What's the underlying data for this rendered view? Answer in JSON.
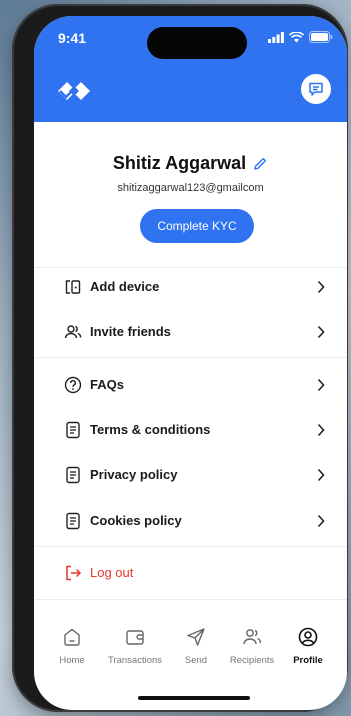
{
  "status": {
    "time": "9:41"
  },
  "header": {
    "brand_color": "#2f73f1"
  },
  "profile": {
    "name": "Shitiz Aggarwal",
    "email": "shitizaggarwal123@gmailcom",
    "kyc_label": "Complete KYC"
  },
  "menu": {
    "add_device": "Add device",
    "invite_friends": "Invite friends",
    "faqs": "FAQs",
    "terms": "Terms & conditions",
    "privacy": "Privacy policy",
    "cookies": "Cookies policy",
    "logout": "Log out"
  },
  "tabs": [
    {
      "label": "Home",
      "icon": "home-icon"
    },
    {
      "label": "Transactions",
      "icon": "wallet-icon"
    },
    {
      "label": "Send",
      "icon": "send-icon"
    },
    {
      "label": "Recipients",
      "icon": "recipients-icon"
    },
    {
      "label": "Profile",
      "icon": "profile-icon",
      "active": true
    }
  ],
  "colors": {
    "accent": "#2f73f1",
    "danger": "#e5362f"
  }
}
